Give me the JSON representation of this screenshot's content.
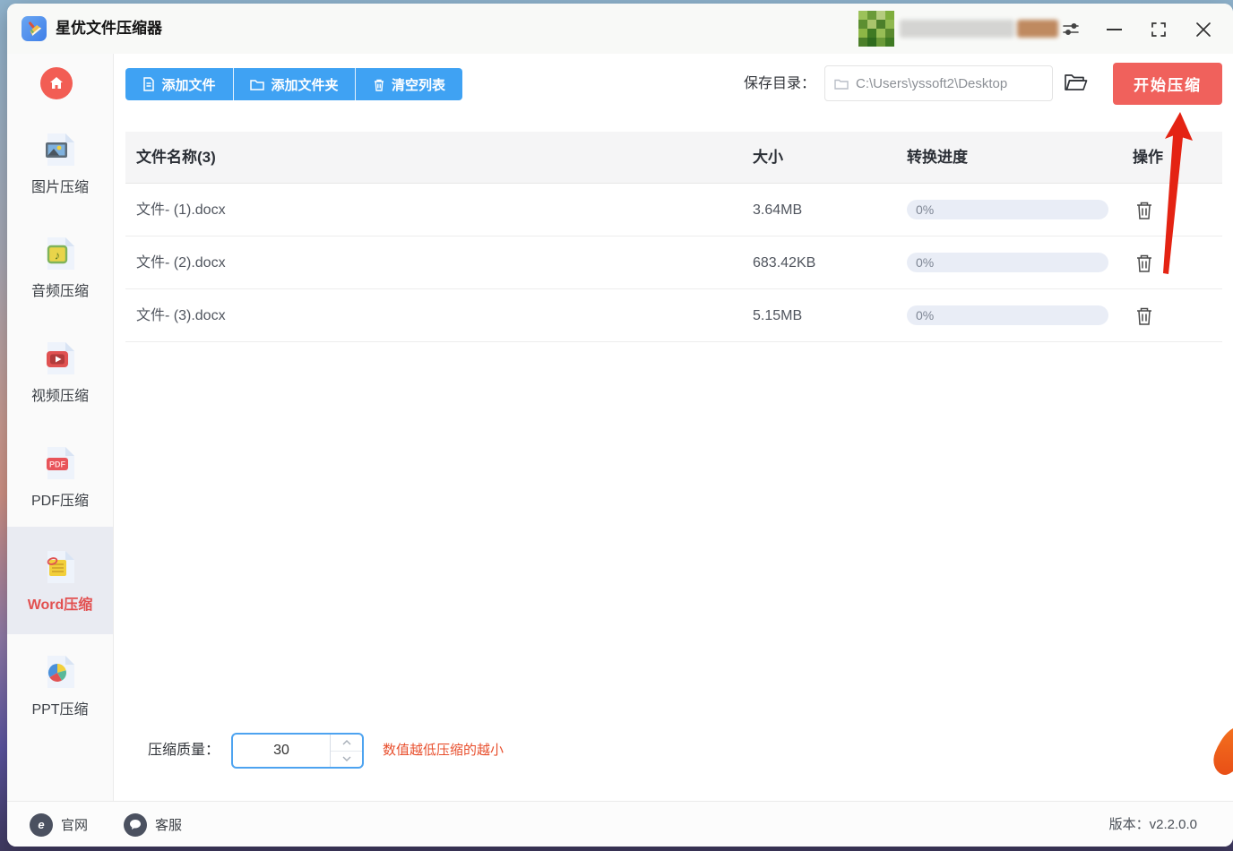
{
  "titlebar": {
    "title": "星优文件压缩器",
    "controls": {
      "minimize": "minimize",
      "maximize": "maximize",
      "close": "close",
      "settings": "settings-sliders"
    }
  },
  "sidebar": {
    "home_icon": "home-icon",
    "items": [
      {
        "label": "图片压缩",
        "icon": "image-file-icon",
        "selected": false
      },
      {
        "label": "音频压缩",
        "icon": "audio-file-icon",
        "selected": false
      },
      {
        "label": "视频压缩",
        "icon": "video-file-icon",
        "selected": false
      },
      {
        "label": "PDF压缩",
        "icon": "pdf-file-icon",
        "selected": false
      },
      {
        "label": "Word压缩",
        "icon": "word-file-icon",
        "selected": true
      },
      {
        "label": "PPT压缩",
        "icon": "ppt-file-icon",
        "selected": false
      }
    ]
  },
  "toolbar": {
    "add_file": "添加文件",
    "add_folder": "添加文件夹",
    "clear_list": "清空列表",
    "save_dir_label": "保存目录：",
    "save_dir_path": "C:\\Users\\yssoft2\\Desktop",
    "start_button": "开始压缩"
  },
  "table": {
    "header": {
      "name": "文件名称(3)",
      "size": "大小",
      "progress": "转换进度",
      "action": "操作"
    },
    "rows": [
      {
        "name": "文件- (1).docx",
        "size": "3.64MB",
        "progress": "0%"
      },
      {
        "name": "文件- (2).docx",
        "size": "683.42KB",
        "progress": "0%"
      },
      {
        "name": "文件- (3).docx",
        "size": "5.15MB",
        "progress": "0%"
      }
    ]
  },
  "quality": {
    "label": "压缩质量：",
    "value": "30",
    "hint": "数值越低压缩的越小"
  },
  "footer": {
    "website": "官网",
    "support": "客服",
    "version": "版本：v2.2.0.0"
  },
  "colors": {
    "accent_blue": "#3fa2f3",
    "start_button_red": "#f0615c",
    "hint_orange": "#e84f2d",
    "annotation_arrow_red": "#e42313",
    "sidebar_selected_bg": "#e9ebf2",
    "progress_track": "#e9edf6"
  }
}
